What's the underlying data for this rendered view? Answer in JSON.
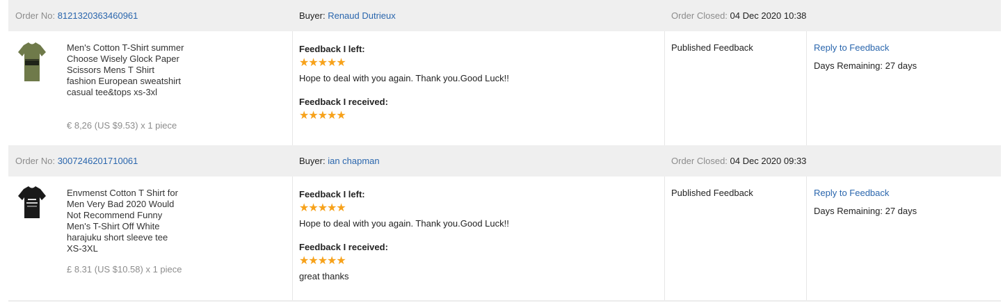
{
  "orders": [
    {
      "order_label": "Order No:",
      "order_no": "8121320363460961",
      "buyer_label": "Buyer:",
      "buyer_name": "Renaud Dutrieux",
      "closed_label": "Order Closed:",
      "closed_date": "04 Dec 2020 10:38",
      "product_icon": "olive-tshirt-icon",
      "product_name": "Men's Cotton T-Shirt summer Choose Wisely Glock Paper Scissors Mens T Shirt fashion European sweatshirt casual tee&tops xs-3xl",
      "price": "€ 8,26 (US $9.53) x 1 piece",
      "left_title": "Feedback I left:",
      "left_stars": "★★★★★",
      "left_text": "Hope to deal with you again. Thank you.Good Luck!!",
      "received_title": "Feedback I received:",
      "received_stars": "★★★★★",
      "received_text": "",
      "status": "Published Feedback",
      "action_link": "Reply to Feedback",
      "days_remaining": "Days Remaining: 27 days"
    },
    {
      "order_label": "Order No:",
      "order_no": "3007246201710061",
      "buyer_label": "Buyer:",
      "buyer_name": "ian chapman",
      "closed_label": "Order Closed:",
      "closed_date": "04 Dec 2020 09:33",
      "product_icon": "black-tshirt-icon",
      "product_name": "Envmenst Cotton T Shirt for Men Very Bad 2020 Would Not Recommend Funny Men's T-Shirt Off White harajuku short sleeve tee XS-3XL",
      "price": "£ 8.31 (US $10.58) x 1 piece",
      "left_title": "Feedback I left:",
      "left_stars": "★★★★★",
      "left_text": "Hope to deal with you again. Thank you.Good Luck!!",
      "received_title": "Feedback I received:",
      "received_stars": "★★★★★",
      "received_text": "great thanks",
      "status": "Published Feedback",
      "action_link": "Reply to Feedback",
      "days_remaining": "Days Remaining: 27 days"
    }
  ],
  "colors": {
    "link": "#2a66ad",
    "star": "#f7a21b",
    "header_bg": "#efefef",
    "muted": "#8c8c8c"
  }
}
